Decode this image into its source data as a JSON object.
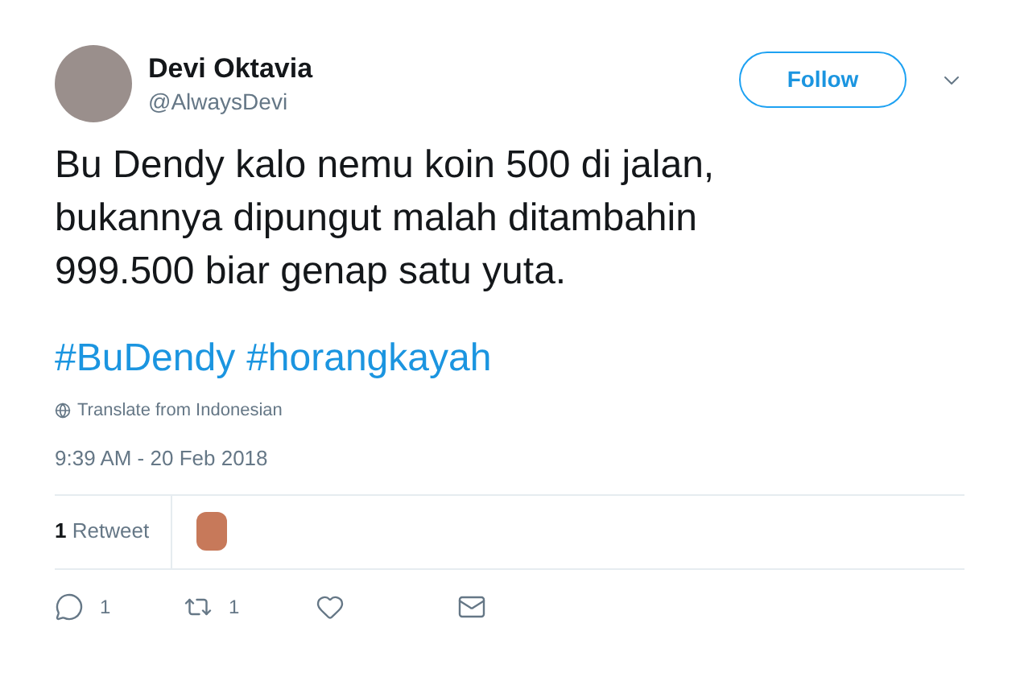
{
  "author": {
    "name": "Devi Oktavia",
    "handle": "@AlwaysDevi"
  },
  "follow_button": {
    "label": "Follow"
  },
  "tweet_text": [
    "Bu Dendy kalo nemu koin 500 di jalan,",
    "bukannya dipungut malah ditambahin",
    "999.500 biar genap satu yuta."
  ],
  "hashtags": [
    "#BuDendy",
    "#horangkayah"
  ],
  "translate_link": "Translate from Indonesian",
  "timestamp": "9:39 AM - 20 Feb 2018",
  "retweet_stats": {
    "count": "1",
    "label": "Retweet"
  },
  "actions": [
    {
      "kind": "reply",
      "count": "1"
    },
    {
      "kind": "retweet",
      "count": "1"
    },
    {
      "kind": "like"
    },
    {
      "kind": "message"
    }
  ]
}
